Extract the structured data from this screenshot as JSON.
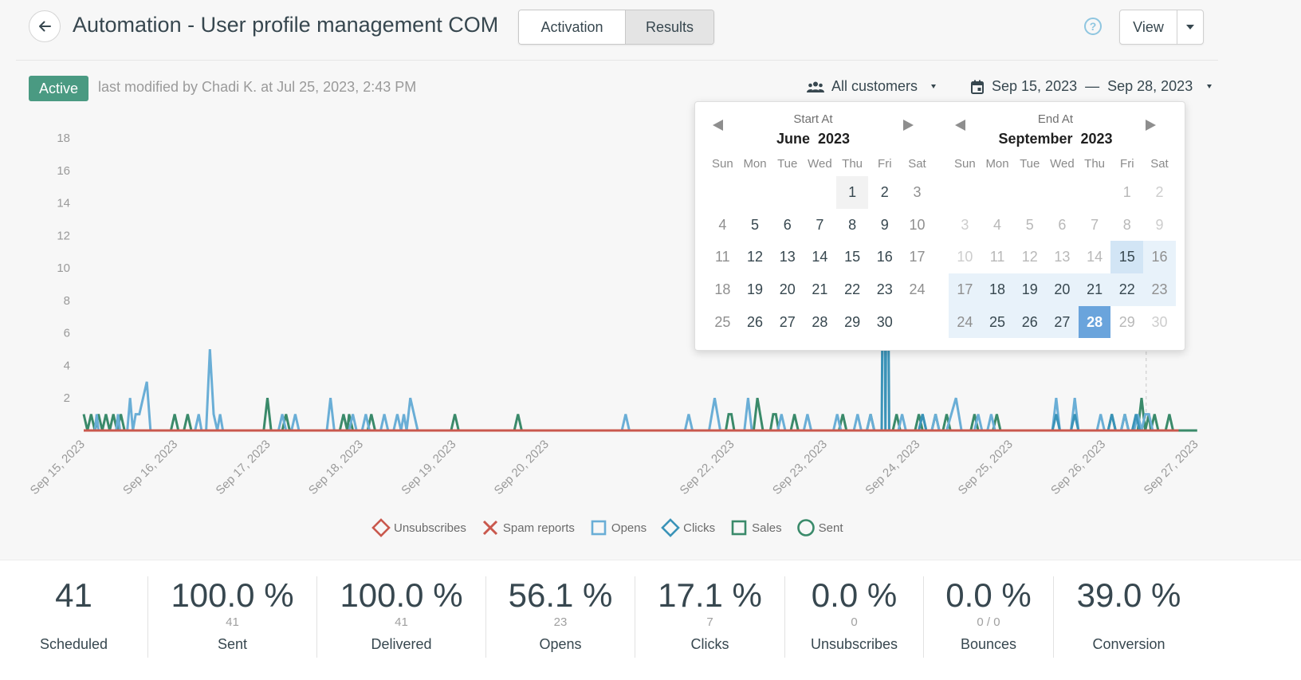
{
  "header": {
    "title": "Automation - User profile management COM",
    "tabs": [
      {
        "label": "Activation",
        "active": false
      },
      {
        "label": "Results",
        "active": true
      }
    ],
    "help_icon": "question-circle-icon",
    "view_label": "View"
  },
  "status": {
    "badge": "Active",
    "badge_color": "#4a9a82",
    "modified_text": "last modified by Chadi K. at Jul 25, 2023, 2:43 PM"
  },
  "filters": {
    "customers_label": "All customers",
    "date_start": "Sep 15, 2023",
    "date_sep": "—",
    "date_end": "Sep 28, 2023"
  },
  "calendar": {
    "weekdays": [
      "Sun",
      "Mon",
      "Tue",
      "Wed",
      "Thu",
      "Fri",
      "Sat"
    ],
    "start": {
      "caption": "Start At",
      "month": "June",
      "year": "2023",
      "first_weekday": 4,
      "days": 30,
      "today": 1
    },
    "end": {
      "caption": "End At",
      "month": "September",
      "year": "2023",
      "first_weekday": 5,
      "days": 30,
      "range_start": 15,
      "range_end": 28,
      "disabled_before": 15,
      "disabled_after": 28
    }
  },
  "chart_data": {
    "type": "line",
    "title": "",
    "xlabel": "",
    "ylabel": "",
    "ylim": [
      0,
      18
    ],
    "y_ticks": [
      2,
      4,
      6,
      8,
      10,
      12,
      14,
      16,
      18
    ],
    "x_ticks": [
      "Sep 15, 2023",
      "Sep 16, 2023",
      "Sep 17, 2023",
      "Sep 18, 2023",
      "Sep 19, 2023",
      "Sep 20, 2023",
      "Sep 22, 2023",
      "Sep 23, 2023",
      "Sep 24, 2023",
      "Sep 25, 2023",
      "Sep 26, 2023",
      "Sep 27, 2023"
    ],
    "grid": false,
    "legend_position": "bottom",
    "legend": [
      {
        "name": "Unsubscribes",
        "symbol": "diamond",
        "color": "#c9584d"
      },
      {
        "name": "Spam reports",
        "symbol": "x",
        "color": "#c9584d"
      },
      {
        "name": "Opens",
        "symbol": "square",
        "color": "#6aaed6"
      },
      {
        "name": "Clicks",
        "symbol": "diamond",
        "color": "#3a93b8"
      },
      {
        "name": "Sales",
        "symbol": "square",
        "color": "#3a8a6a"
      },
      {
        "name": "Sent",
        "symbol": "circle",
        "color": "#3a8a6a"
      }
    ],
    "series": [
      {
        "name": "Opens",
        "color": "#6aaed6",
        "points": [
          [
            0.12,
            0
          ],
          [
            0.14,
            1
          ],
          [
            0.16,
            0
          ],
          [
            0.35,
            0
          ],
          [
            0.37,
            1
          ],
          [
            0.39,
            0
          ],
          [
            0.47,
            0
          ],
          [
            0.5,
            2
          ],
          [
            0.53,
            0
          ],
          [
            0.56,
            1
          ],
          [
            0.6,
            1
          ],
          [
            0.68,
            3
          ],
          [
            0.72,
            0
          ],
          [
            1.2,
            0
          ],
          [
            1.24,
            1
          ],
          [
            1.27,
            0
          ],
          [
            1.32,
            0
          ],
          [
            1.36,
            5
          ],
          [
            1.4,
            1
          ],
          [
            1.44,
            0
          ],
          [
            1.47,
            1
          ],
          [
            1.5,
            0
          ],
          [
            2.1,
            0
          ],
          [
            2.14,
            1
          ],
          [
            2.18,
            0
          ],
          [
            2.24,
            0
          ],
          [
            2.28,
            1
          ],
          [
            2.32,
            0
          ],
          [
            2.62,
            0
          ],
          [
            2.66,
            2
          ],
          [
            2.7,
            0
          ],
          [
            2.86,
            0
          ],
          [
            2.9,
            1
          ],
          [
            2.94,
            0
          ],
          [
            3.0,
            0
          ],
          [
            3.04,
            1
          ],
          [
            3.08,
            0
          ],
          [
            3.2,
            0
          ],
          [
            3.24,
            1
          ],
          [
            3.28,
            0
          ],
          [
            3.34,
            0
          ],
          [
            3.38,
            1
          ],
          [
            3.42,
            0
          ],
          [
            3.45,
            1
          ],
          [
            3.48,
            0
          ],
          [
            3.52,
            2
          ],
          [
            3.6,
            0
          ],
          [
            5.8,
            0
          ],
          [
            5.84,
            1
          ],
          [
            5.88,
            0
          ],
          [
            6.48,
            0
          ],
          [
            6.52,
            1
          ],
          [
            6.56,
            0
          ],
          [
            6.74,
            0
          ],
          [
            6.8,
            2
          ],
          [
            6.86,
            0
          ],
          [
            7.12,
            0
          ],
          [
            7.16,
            2
          ],
          [
            7.2,
            0
          ],
          [
            7.48,
            0
          ],
          [
            7.52,
            1
          ],
          [
            7.56,
            0
          ],
          [
            7.76,
            0
          ],
          [
            7.8,
            1
          ],
          [
            7.84,
            0
          ],
          [
            8.08,
            0
          ],
          [
            8.12,
            1
          ],
          [
            8.16,
            0
          ],
          [
            8.3,
            0
          ],
          [
            8.34,
            1
          ],
          [
            8.38,
            0
          ],
          [
            8.44,
            0
          ],
          [
            8.48,
            1
          ],
          [
            8.52,
            0
          ],
          [
            8.78,
            0
          ],
          [
            8.82,
            1
          ],
          [
            8.86,
            0
          ],
          [
            9.0,
            0
          ],
          [
            9.04,
            1
          ],
          [
            9.08,
            0
          ],
          [
            9.14,
            0
          ],
          [
            9.18,
            1
          ],
          [
            9.22,
            0
          ],
          [
            9.3,
            0
          ],
          [
            9.4,
            2
          ],
          [
            9.46,
            0
          ],
          [
            9.6,
            0
          ],
          [
            9.64,
            1
          ],
          [
            9.68,
            0
          ],
          [
            9.74,
            0
          ],
          [
            9.78,
            1
          ],
          [
            9.82,
            0
          ],
          [
            10.44,
            0
          ],
          [
            10.48,
            2
          ],
          [
            10.52,
            0
          ],
          [
            10.64,
            0
          ],
          [
            10.68,
            2
          ],
          [
            10.72,
            0
          ],
          [
            10.92,
            0
          ],
          [
            10.96,
            1
          ],
          [
            11.0,
            0
          ],
          [
            11.18,
            0
          ],
          [
            11.22,
            1
          ],
          [
            11.26,
            0
          ],
          [
            11.32,
            0
          ],
          [
            11.36,
            1
          ],
          [
            11.4,
            0
          ],
          [
            11.44,
            1
          ],
          [
            11.48,
            1
          ],
          [
            11.52,
            0
          ]
        ]
      },
      {
        "name": "Clicks",
        "color": "#3a93b8",
        "points": [
          [
            8.6,
            0
          ],
          [
            8.62,
            18
          ],
          [
            8.64,
            0
          ],
          [
            8.66,
            18
          ],
          [
            8.68,
            0
          ],
          [
            9.0,
            0
          ],
          [
            9.04,
            1
          ],
          [
            9.08,
            0
          ],
          [
            10.44,
            0
          ],
          [
            10.48,
            1
          ],
          [
            10.52,
            0
          ],
          [
            10.64,
            0
          ],
          [
            10.68,
            1
          ],
          [
            10.72,
            0
          ],
          [
            11.04,
            0
          ],
          [
            11.08,
            1
          ],
          [
            11.12,
            0
          ],
          [
            11.3,
            0
          ],
          [
            11.34,
            1
          ],
          [
            11.38,
            0
          ]
        ]
      },
      {
        "name": "Sales",
        "color": "#3a8a6a",
        "points": [
          [
            0,
            1
          ],
          [
            0.04,
            0
          ],
          [
            0.08,
            1
          ],
          [
            0.12,
            0
          ],
          [
            0.16,
            1
          ],
          [
            0.2,
            0
          ],
          [
            0.24,
            1
          ],
          [
            0.28,
            0
          ],
          [
            0.32,
            1
          ],
          [
            0.36,
            0
          ],
          [
            0.4,
            1
          ],
          [
            0.44,
            0
          ],
          [
            0.94,
            0
          ],
          [
            0.98,
            1
          ],
          [
            1.02,
            0
          ],
          [
            1.08,
            0
          ],
          [
            1.12,
            1
          ],
          [
            1.16,
            0
          ],
          [
            1.94,
            0
          ],
          [
            1.98,
            2
          ],
          [
            2.02,
            0
          ],
          [
            2.14,
            0
          ],
          [
            2.18,
            1
          ],
          [
            2.22,
            0
          ],
          [
            2.76,
            0
          ],
          [
            2.8,
            1
          ],
          [
            2.84,
            0
          ],
          [
            2.86,
            1
          ],
          [
            2.9,
            0
          ],
          [
            3.06,
            0
          ],
          [
            3.1,
            1
          ],
          [
            3.14,
            0
          ],
          [
            3.96,
            0
          ],
          [
            4.0,
            1
          ],
          [
            4.04,
            0
          ],
          [
            4.64,
            0
          ],
          [
            4.68,
            1
          ],
          [
            4.72,
            0
          ],
          [
            6.92,
            0
          ],
          [
            6.95,
            1
          ],
          [
            6.98,
            1
          ],
          [
            7.01,
            0
          ],
          [
            7.22,
            0
          ],
          [
            7.26,
            2
          ],
          [
            7.32,
            0
          ],
          [
            7.4,
            0
          ],
          [
            7.43,
            1
          ],
          [
            7.46,
            1
          ],
          [
            7.49,
            0
          ],
          [
            7.62,
            0
          ],
          [
            7.66,
            1
          ],
          [
            7.7,
            0
          ],
          [
            8.14,
            0
          ],
          [
            8.18,
            1
          ],
          [
            8.22,
            0
          ],
          [
            8.44,
            0
          ],
          [
            8.48,
            1
          ],
          [
            8.52,
            0
          ],
          [
            8.72,
            0
          ],
          [
            8.76,
            1
          ],
          [
            8.8,
            0
          ],
          [
            8.96,
            0
          ],
          [
            9.0,
            1
          ],
          [
            9.04,
            0
          ],
          [
            9.14,
            0
          ],
          [
            9.18,
            1
          ],
          [
            9.22,
            0
          ],
          [
            9.26,
            0
          ],
          [
            9.3,
            1
          ],
          [
            9.34,
            0
          ],
          [
            9.56,
            0
          ],
          [
            9.6,
            1
          ],
          [
            9.64,
            0
          ],
          [
            9.8,
            0
          ],
          [
            9.84,
            1
          ],
          [
            9.88,
            0
          ],
          [
            11.04,
            0
          ],
          [
            11.08,
            1
          ],
          [
            11.12,
            0
          ],
          [
            11.18,
            0
          ],
          [
            11.22,
            1
          ],
          [
            11.26,
            0
          ],
          [
            11.36,
            0
          ],
          [
            11.4,
            2
          ],
          [
            11.44,
            0
          ],
          [
            11.48,
            1
          ],
          [
            11.5,
            0
          ],
          [
            11.54,
            1
          ],
          [
            11.58,
            0
          ],
          [
            11.66,
            0
          ],
          [
            11.7,
            1
          ],
          [
            11.74,
            0
          ],
          [
            11.8,
            0
          ],
          [
            12.0,
            0
          ]
        ]
      },
      {
        "name": "Unsubscribes",
        "color": "#c9584d",
        "points": [
          [
            0,
            0
          ],
          [
            11.8,
            0
          ]
        ]
      }
    ]
  },
  "stats": [
    {
      "value": "41",
      "sub": "",
      "label": "Scheduled"
    },
    {
      "value": "100.0 %",
      "sub": "41",
      "label": "Sent"
    },
    {
      "value": "100.0 %",
      "sub": "41",
      "label": "Delivered"
    },
    {
      "value": "56.1 %",
      "sub": "23",
      "label": "Opens"
    },
    {
      "value": "17.1 %",
      "sub": "7",
      "label": "Clicks"
    },
    {
      "value": "0.0 %",
      "sub": "0",
      "label": "Unsubscribes"
    },
    {
      "value": "0.0 %",
      "sub": "0 / 0",
      "label": "Bounces"
    },
    {
      "value": "39.0 %",
      "sub": "",
      "label": "Conversion"
    }
  ]
}
